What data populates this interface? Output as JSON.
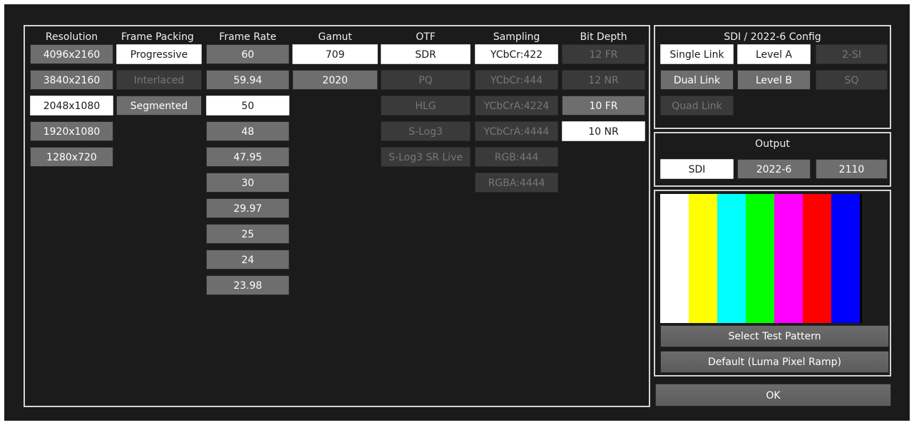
{
  "columns": {
    "resolution": {
      "title": "Resolution",
      "items": [
        {
          "label": "4096x2160",
          "state": "std"
        },
        {
          "label": "3840x2160",
          "state": "std"
        },
        {
          "label": "2048x1080",
          "state": "sel"
        },
        {
          "label": "1920x1080",
          "state": "std"
        },
        {
          "label": "1280x720",
          "state": "std"
        }
      ]
    },
    "frame_packing": {
      "title": "Frame Packing",
      "items": [
        {
          "label": "Progressive",
          "state": "sel"
        },
        {
          "label": "Interlaced",
          "state": "dis"
        },
        {
          "label": "Segmented",
          "state": "std"
        }
      ]
    },
    "frame_rate": {
      "title": "Frame Rate",
      "items": [
        {
          "label": "60",
          "state": "std"
        },
        {
          "label": "59.94",
          "state": "std"
        },
        {
          "label": "50",
          "state": "sel"
        },
        {
          "label": "48",
          "state": "std"
        },
        {
          "label": "47.95",
          "state": "std"
        },
        {
          "label": "30",
          "state": "std"
        },
        {
          "label": "29.97",
          "state": "std"
        },
        {
          "label": "25",
          "state": "std"
        },
        {
          "label": "24",
          "state": "std"
        },
        {
          "label": "23.98",
          "state": "std"
        }
      ]
    },
    "gamut": {
      "title": "Gamut",
      "items": [
        {
          "label": "709",
          "state": "sel"
        },
        {
          "label": "2020",
          "state": "std"
        }
      ]
    },
    "otf": {
      "title": "OTF",
      "items": [
        {
          "label": "SDR",
          "state": "sel"
        },
        {
          "label": "PQ",
          "state": "dis"
        },
        {
          "label": "HLG",
          "state": "dis"
        },
        {
          "label": "S-Log3",
          "state": "dis"
        },
        {
          "label": "S-Log3 SR Live",
          "state": "dis"
        }
      ]
    },
    "sampling": {
      "title": "Sampling",
      "items": [
        {
          "label": "YCbCr:422",
          "state": "sel"
        },
        {
          "label": "YCbCr:444",
          "state": "dis"
        },
        {
          "label": "YCbCrA:4224",
          "state": "dis"
        },
        {
          "label": "YCbCrA:4444",
          "state": "dis"
        },
        {
          "label": "RGB:444",
          "state": "dis"
        },
        {
          "label": "RGBA:4444",
          "state": "dis"
        }
      ]
    },
    "bit_depth": {
      "title": "Bit Depth",
      "items": [
        {
          "label": "12 FR",
          "state": "dis"
        },
        {
          "label": "12 NR",
          "state": "dis"
        },
        {
          "label": "10 FR",
          "state": "std"
        },
        {
          "label": "10 NR",
          "state": "sel"
        }
      ]
    }
  },
  "sdi_config": {
    "title": "SDI / 2022-6 Config",
    "links": [
      {
        "label": "Single Link",
        "state": "sel"
      },
      {
        "label": "Dual Link",
        "state": "std"
      },
      {
        "label": "Quad Link",
        "state": "dis"
      }
    ],
    "levels": [
      {
        "label": "Level A",
        "state": "sel"
      },
      {
        "label": "Level B",
        "state": "std"
      }
    ],
    "modes": [
      {
        "label": "2-SI",
        "state": "dis"
      },
      {
        "label": "SQ",
        "state": "dis"
      }
    ]
  },
  "output": {
    "title": "Output",
    "items": [
      {
        "label": "SDI",
        "state": "sel"
      },
      {
        "label": "2022-6",
        "state": "std"
      },
      {
        "label": "2110",
        "state": "std"
      }
    ]
  },
  "test_pattern": {
    "colors": [
      "#ffffff",
      "#ffff00",
      "#00ffff",
      "#00ff00",
      "#ff00ff",
      "#ff0000",
      "#0000ff"
    ],
    "select_label": "Select Test Pattern",
    "default_label": "Default (Luma Pixel Ramp)"
  },
  "ok_label": "OK"
}
